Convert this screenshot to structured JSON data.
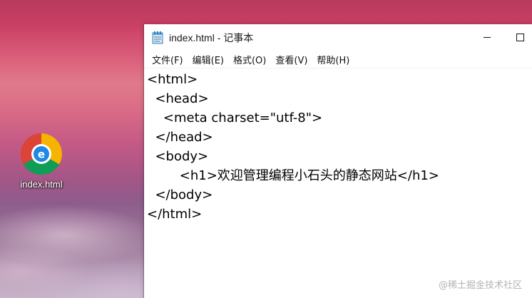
{
  "desktop": {
    "icon_label": "index.html",
    "icon_name": "chrome-icon"
  },
  "window": {
    "title": "index.html - 记事本",
    "app_icon": "notepad-icon",
    "controls": {
      "minimize": "minimize-icon",
      "maximize": "maximize-icon"
    }
  },
  "menu": [
    {
      "label": "文件(F)"
    },
    {
      "label": "编辑(E)"
    },
    {
      "label": "格式(O)"
    },
    {
      "label": "查看(V)"
    },
    {
      "label": "帮助(H)"
    }
  ],
  "editor": {
    "lines": [
      "<html>",
      "  <head>",
      "    <meta charset=\"utf-8\">",
      "  </head>",
      "  <body>",
      "\t\t<h1>欢迎管理编程小石头的静态网站</h1>",
      "  </body>",
      "</html>"
    ]
  },
  "watermark": "@稀土掘金技术社区",
  "colors": {
    "chrome_red": "#DB4437",
    "chrome_yellow": "#F4B400",
    "chrome_green": "#0F9D58",
    "chrome_blue": "#1E88E5",
    "window_bg": "#FFFFFF"
  }
}
